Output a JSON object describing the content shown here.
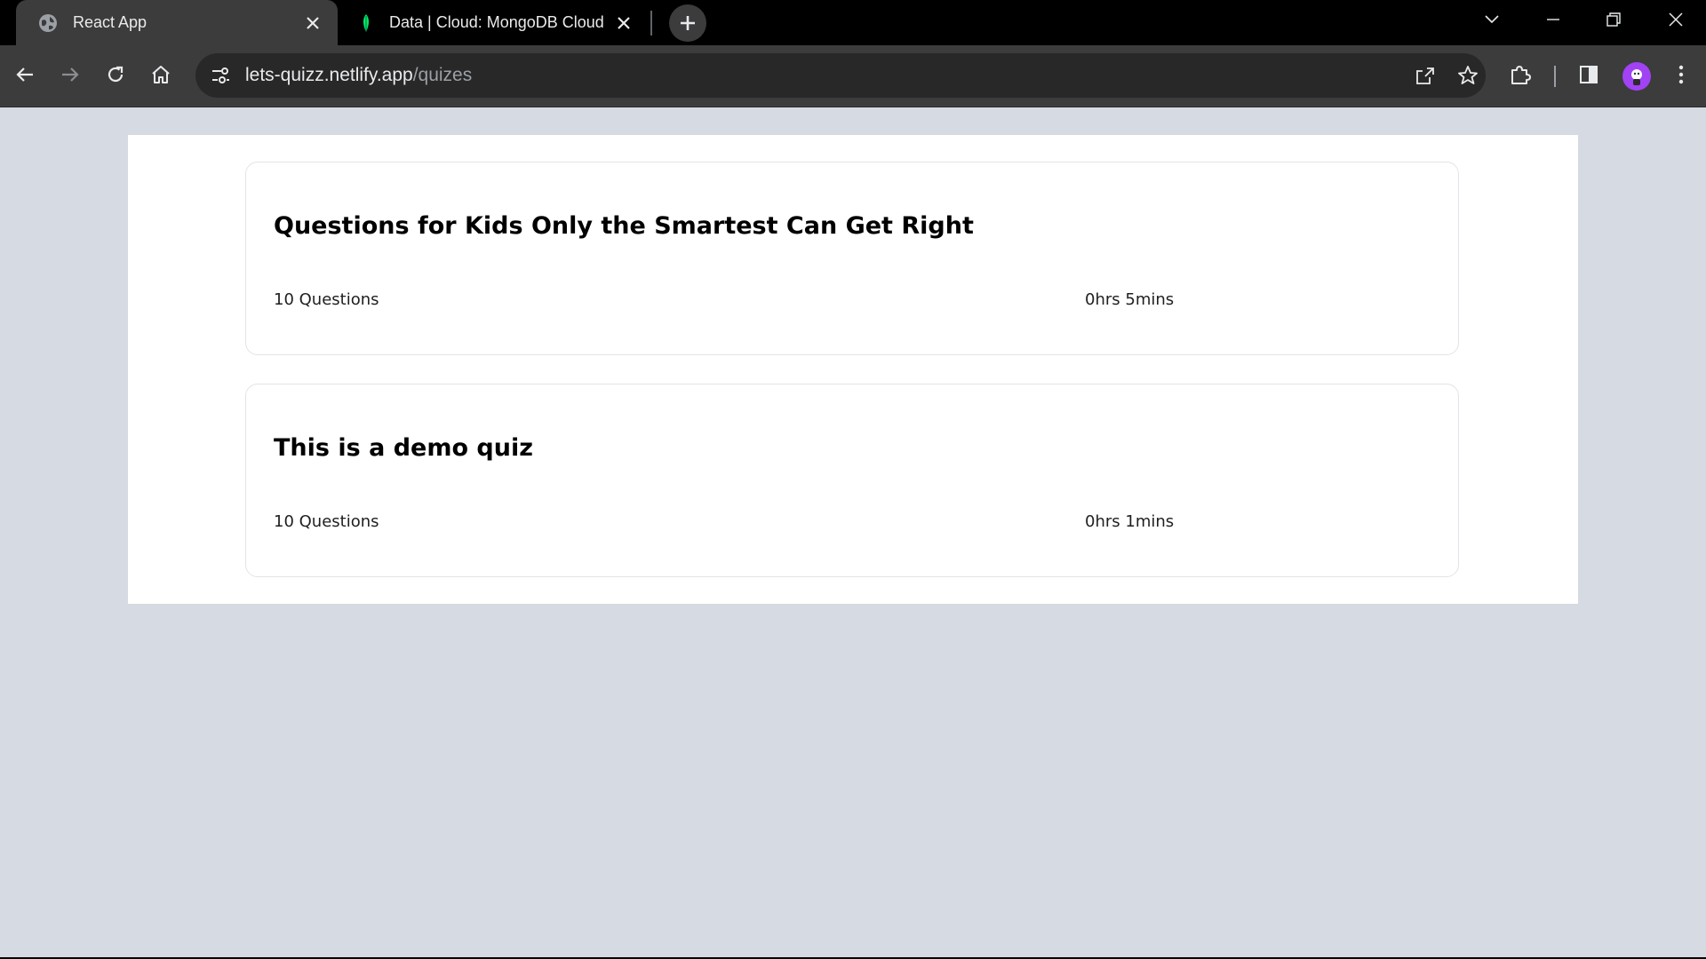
{
  "browser": {
    "tabs": [
      {
        "title": "React App",
        "favicon": "globe-icon",
        "active": true
      },
      {
        "title": "Data | Cloud: MongoDB Cloud",
        "favicon": "mongodb-leaf-icon",
        "active": false
      }
    ],
    "address": {
      "host": "lets-quizz.netlify.app",
      "path": "/quizes"
    },
    "colors": {
      "titlebar": "#000000",
      "toolbar": "#3c3c3c",
      "omnibox": "#282828",
      "page_background": "#d6dae2",
      "avatar": "#a142f4",
      "mongodb_leaf": "#00ed64"
    }
  },
  "quizzes": [
    {
      "title": "Questions for Kids Only the Smartest Can Get Right",
      "questions": "10 Questions",
      "duration": "0hrs 5mins"
    },
    {
      "title": "This is a demo quiz",
      "questions": "10 Questions",
      "duration": "0hrs 1mins"
    }
  ]
}
